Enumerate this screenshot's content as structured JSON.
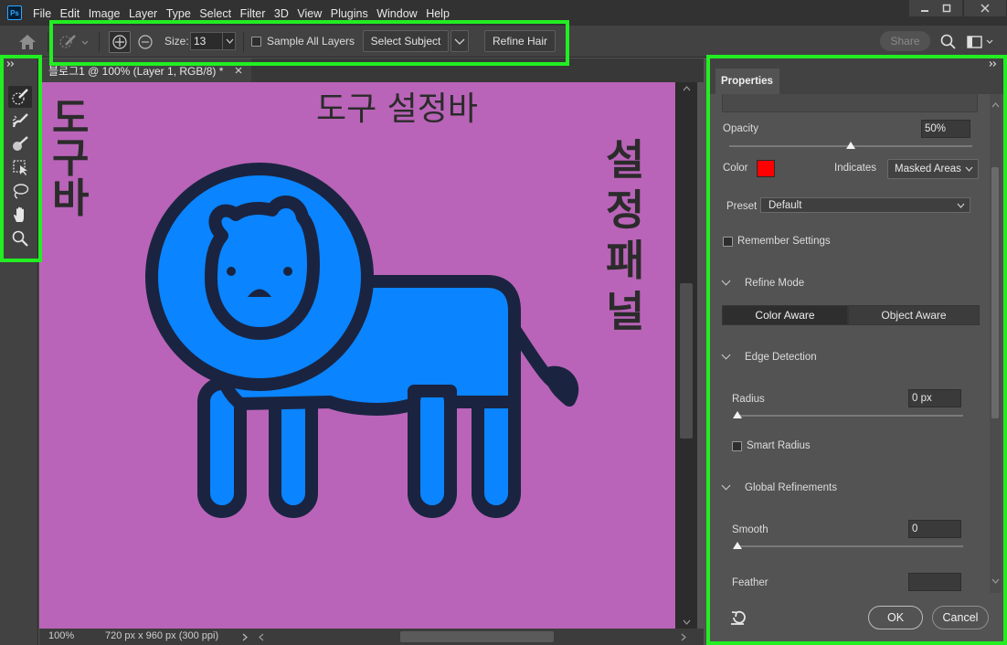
{
  "app": {
    "logo": "Ps"
  },
  "menubar": {
    "items": [
      "File",
      "Edit",
      "Image",
      "Layer",
      "Type",
      "Select",
      "Filter",
      "3D",
      "View",
      "Plugins",
      "Window",
      "Help"
    ]
  },
  "options": {
    "size_label": "Size:",
    "size_value": "13",
    "sample_all_layers": "Sample All Layers",
    "select_subject": "Select Subject",
    "refine_hair": "Refine Hair",
    "share": "Share"
  },
  "document": {
    "tab_title": "블로그1 @ 100% (Layer 1, RGB/8) *",
    "zoom": "100%",
    "info": "720 px x 960 px (300 ppi)",
    "annotations": {
      "toolbar_label": [
        "도",
        "구",
        "바"
      ],
      "options_label": "도구 설정바",
      "panel_label": [
        "설",
        "정",
        "패",
        "널"
      ]
    }
  },
  "properties": {
    "tab": "Properties",
    "opacity_label": "Opacity",
    "opacity_value": "50%",
    "opacity_level": 0.5,
    "color_label": "Color",
    "color_value": "#ff0000",
    "indicates_label": "Indicates",
    "indicates_value": "Masked Areas",
    "preset_label": "Preset",
    "preset_value": "Default",
    "remember_settings": "Remember Settings",
    "refine_mode": "Refine Mode",
    "color_aware": "Color Aware",
    "object_aware": "Object Aware",
    "edge_detection": "Edge Detection",
    "radius_label": "Radius",
    "radius_value": "0 px",
    "smart_radius": "Smart Radius",
    "global_refinements": "Global Refinements",
    "smooth_label": "Smooth",
    "smooth_value": "0",
    "feather_label": "Feather",
    "ok": "OK",
    "cancel": "Cancel"
  },
  "colors": {
    "highlight": "#22ee22",
    "canvas_bg": "#b964b8",
    "lion_fill": "#0a84ff",
    "lion_stroke": "#1a2440"
  },
  "icons": [
    "home-icon",
    "quick-selection-brush-icon",
    "add-to-selection-icon",
    "subtract-from-selection-icon",
    "search-icon",
    "workspace-icon",
    "refine-edge-brush-icon",
    "brush-icon",
    "object-selection-icon",
    "lasso-icon",
    "hand-icon",
    "zoom-icon",
    "reset-icon"
  ]
}
